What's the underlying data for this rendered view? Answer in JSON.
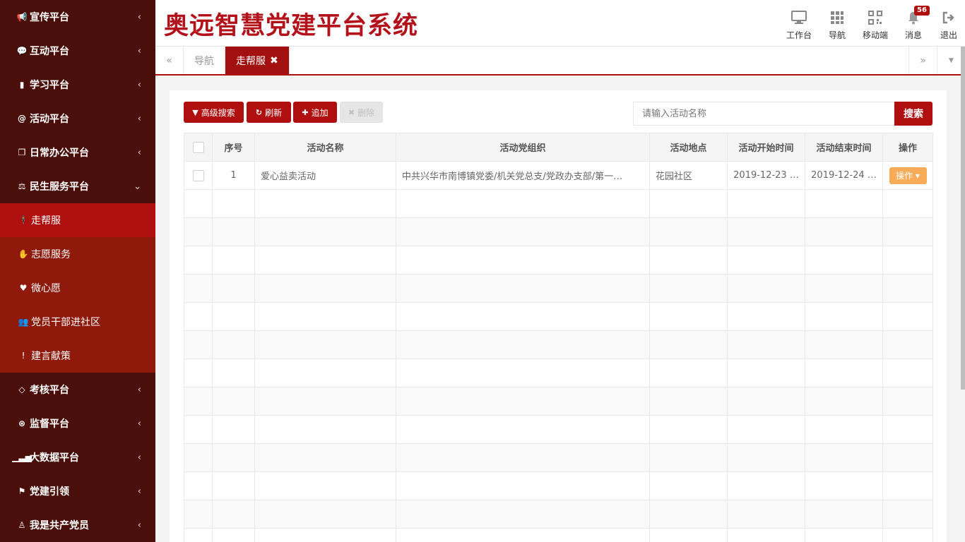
{
  "app": {
    "title": "奥远智慧党建平台系统"
  },
  "sidebar": {
    "top_items": [
      {
        "label": "宣传平台",
        "icon": "bullhorn-icon"
      },
      {
        "label": "互动平台",
        "icon": "comments-icon"
      },
      {
        "label": "学习平台",
        "icon": "book-icon"
      },
      {
        "label": "活动平台",
        "icon": "at-icon"
      },
      {
        "label": "日常办公平台",
        "icon": "copy-icon"
      },
      {
        "label": "民生服务平台",
        "icon": "balance-icon"
      }
    ],
    "sub_items": [
      {
        "label": "走帮服",
        "icon": "child-icon"
      },
      {
        "label": "志愿服务",
        "icon": "hand-icon"
      },
      {
        "label": "微心愿",
        "icon": "heart-icon"
      },
      {
        "label": "党员干部进社区",
        "icon": "users-icon"
      },
      {
        "label": "建言献策",
        "icon": "lightbulb-icon"
      }
    ],
    "bottom_items": [
      {
        "label": "考核平台",
        "icon": "diamond-icon"
      },
      {
        "label": "监督平台",
        "icon": "eye-icon"
      },
      {
        "label": "大数据平台",
        "icon": "signal-icon"
      },
      {
        "label": "党建引领",
        "icon": "flag-icon"
      },
      {
        "label": "我是共产党员",
        "icon": "person-icon"
      }
    ]
  },
  "header": {
    "tools": [
      {
        "label": "工作台",
        "icon": "desktop-icon"
      },
      {
        "label": "导航",
        "icon": "grid-icon"
      },
      {
        "label": "移动端",
        "icon": "qrcode-icon"
      },
      {
        "label": "消息",
        "icon": "bell-icon",
        "badge": "56"
      },
      {
        "label": "退出",
        "icon": "logout-icon"
      }
    ]
  },
  "tabs": {
    "items": [
      {
        "label": "导航"
      },
      {
        "label": "走帮服",
        "close": "✖"
      }
    ]
  },
  "toolbar": {
    "advanced_search": "高级搜索",
    "refresh": "刷新",
    "add": "追加",
    "delete": "删除",
    "search_placeholder": "请输入活动名称",
    "search": "搜索"
  },
  "table": {
    "headers": [
      "序号",
      "活动名称",
      "活动党组织",
      "活动地点",
      "活动开始时间",
      "活动结束时间",
      "操作"
    ],
    "rows": [
      {
        "index": "1",
        "name": "爱心益卖活动",
        "org": "中共兴华市南博镇党委/机关党总支/党政办支部/第一…",
        "location": "花园社区",
        "start": "2019-12-23 …",
        "end": "2019-12-24 …",
        "op": "操作 ▾"
      }
    ]
  }
}
